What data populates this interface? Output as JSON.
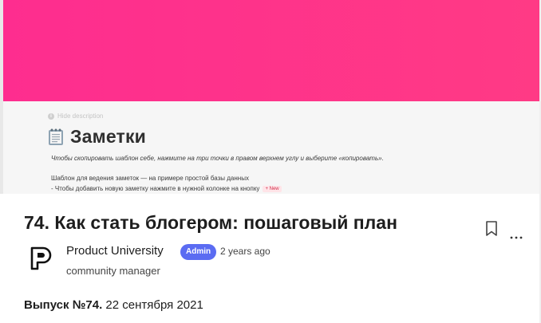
{
  "cover": {
    "banner_color": "#fe2d8f",
    "hide_description": "Hide description",
    "notes_icon": "notepad-icon",
    "notes_title": "Заметки",
    "instruction": "Чтобы скопировать шаблон себе, нажмите на три точки в правом верхнем углу и выберите «копировать».",
    "line1": "Шаблон для ведения заметок — на примере простой базы данных",
    "line2": "- Чтобы добавить новую заметку нажмите в нужной колонке на кнопку",
    "new_tag": "+ New"
  },
  "post": {
    "title": "74. Как стать блогером: пошаговый план",
    "bookmark_icon": "bookmark-icon",
    "more_icon": "more-options-icon",
    "author": {
      "name": "Product University",
      "badge": "Admin",
      "badge_color": "#5b6cf2",
      "time": "2 years ago",
      "role": "community manager",
      "avatar_icon": "product-university-logo"
    },
    "issue_label": "Выпуск №74.",
    "issue_date": " 22 сентября 2021"
  }
}
